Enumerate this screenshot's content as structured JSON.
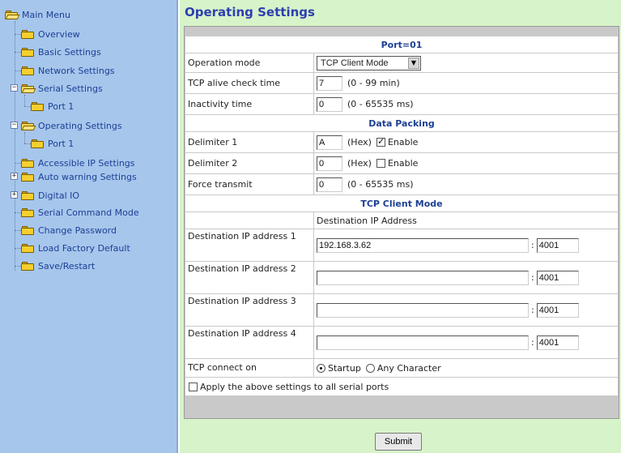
{
  "sidebar": {
    "root": "Main Menu",
    "items": [
      {
        "label": "Overview"
      },
      {
        "label": "Basic Settings"
      },
      {
        "label": "Network Settings"
      },
      {
        "label": "Serial Settings"
      },
      {
        "label": "Port 1"
      },
      {
        "label": "Operating Settings"
      },
      {
        "label": "Port 1"
      },
      {
        "label": "Accessible IP Settings"
      },
      {
        "label": "Auto warning Settings"
      },
      {
        "label": "Digital IO"
      },
      {
        "label": "Serial Command Mode"
      },
      {
        "label": "Change Password"
      },
      {
        "label": "Load Factory Default"
      },
      {
        "label": "Save/Restart"
      }
    ]
  },
  "main": {
    "title": "Operating Settings",
    "port_header": "Port=01",
    "operation_mode": {
      "label": "Operation mode",
      "value": "TCP Client Mode"
    },
    "tcp_alive": {
      "label": "TCP alive check time",
      "value": "7",
      "hint": "(0 - 99 min)"
    },
    "inactivity": {
      "label": "Inactivity time",
      "value": "0",
      "hint": "(0 - 65535 ms)"
    },
    "data_packing_header": "Data Packing",
    "delimiter1": {
      "label": "Delimiter 1",
      "value": "A",
      "unit": "(Hex)",
      "enable_label": "Enable",
      "enabled": true
    },
    "delimiter2": {
      "label": "Delimiter 2",
      "value": "0",
      "unit": "(Hex)",
      "enable_label": "Enable",
      "enabled": false
    },
    "force_transmit": {
      "label": "Force transmit",
      "value": "0",
      "hint": "(0 - 65535 ms)"
    },
    "tcp_client_header": "TCP Client Mode",
    "dest_ip_col_header": "Destination IP Address",
    "destinations": [
      {
        "label": "Destination IP address 1",
        "ip": "192.168.3.62",
        "port": "4001"
      },
      {
        "label": "Destination IP address 2",
        "ip": "",
        "port": "4001"
      },
      {
        "label": "Destination IP address 3",
        "ip": "",
        "port": "4001"
      },
      {
        "label": "Destination IP address 4",
        "ip": "",
        "port": "4001"
      }
    ],
    "colon": ":",
    "tcp_connect": {
      "label": "TCP connect on",
      "options": [
        "Startup",
        "Any Character"
      ],
      "selected": "Startup"
    },
    "apply_all": {
      "label": "Apply the above settings to all serial ports",
      "checked": false
    },
    "submit_label": "Submit"
  }
}
